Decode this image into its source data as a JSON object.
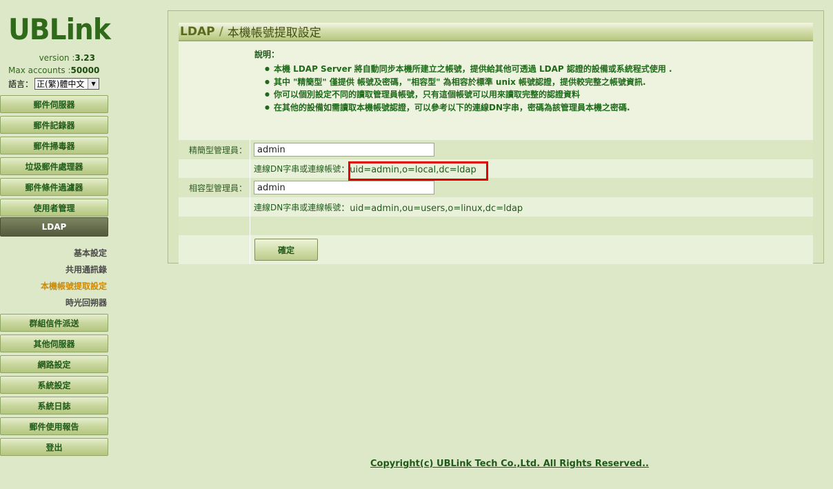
{
  "brand": {
    "logo": "UBLink"
  },
  "sidebar": {
    "version_label": "version :",
    "version_value": "3.23",
    "max_accounts_label": "Max accounts :",
    "max_accounts_value": "50000",
    "language_label": "語言：",
    "language_value": "正(繁)體中文",
    "menu_top": [
      {
        "label": "郵件伺服器"
      },
      {
        "label": "郵件記錄器"
      },
      {
        "label": "郵件掃毒器"
      },
      {
        "label": "垃圾郵件處理器"
      },
      {
        "label": "郵件條件過濾器"
      },
      {
        "label": "使用者管理"
      },
      {
        "label": "LDAP"
      }
    ],
    "submenu": [
      {
        "label": "基本設定"
      },
      {
        "label": "共用通訊錄"
      },
      {
        "label": "本機帳號提取設定"
      },
      {
        "label": "時光回朔器"
      }
    ],
    "menu_bottom": [
      {
        "label": "群組信件派送"
      },
      {
        "label": "其他伺服器"
      },
      {
        "label": "網路設定"
      },
      {
        "label": "系統設定"
      },
      {
        "label": "系統日誌"
      },
      {
        "label": "郵件使用報告"
      },
      {
        "label": "登出"
      }
    ]
  },
  "main": {
    "title_prefix": "LDAP",
    "title_sep": "/",
    "title_suffix": "本機帳號提取設定",
    "desc_heading": "說明：",
    "desc_items": [
      "本機 LDAP Server 將自動同步本機所建立之帳號，提供給其他可透過 LDAP 認證的設備或系統程式使用 .",
      "其中 \"精簡型\" 僅提供 帳號及密碼，\"相容型\" 為相容於標準 unix 帳號認證，提供較完整之帳號資訊.",
      "你可以個別設定不同的讀取管理員帳號，只有這個帳號可以用來讀取完整的認證資料",
      "在其他的設備如需讀取本機帳號認證，可以參考以下的連線DN字串，密碼為該管理員本機之密碼."
    ],
    "simple_admin_label": "精簡型管理員：",
    "simple_admin_value": "admin",
    "simple_dn_label": "連線DN字串或連線帳號",
    "simple_dn_value": "：uid=admin,o=local,dc=ldap",
    "compat_admin_label": "相容型管理員：",
    "compat_admin_value": "admin",
    "compat_dn_label": "連線DN字串或連線帳號",
    "compat_dn_value": "：uid=admin,ou=users,o=linux,dc=ldap",
    "submit_label": "確定"
  },
  "footer": {
    "copyright": "Copyright(c) UBLink Tech Co.,Ltd. All Rights Reserved.."
  },
  "colors": {
    "background": "#dde8c8",
    "highlight_box": "#e00000",
    "active_submenu": "#d08a00"
  }
}
